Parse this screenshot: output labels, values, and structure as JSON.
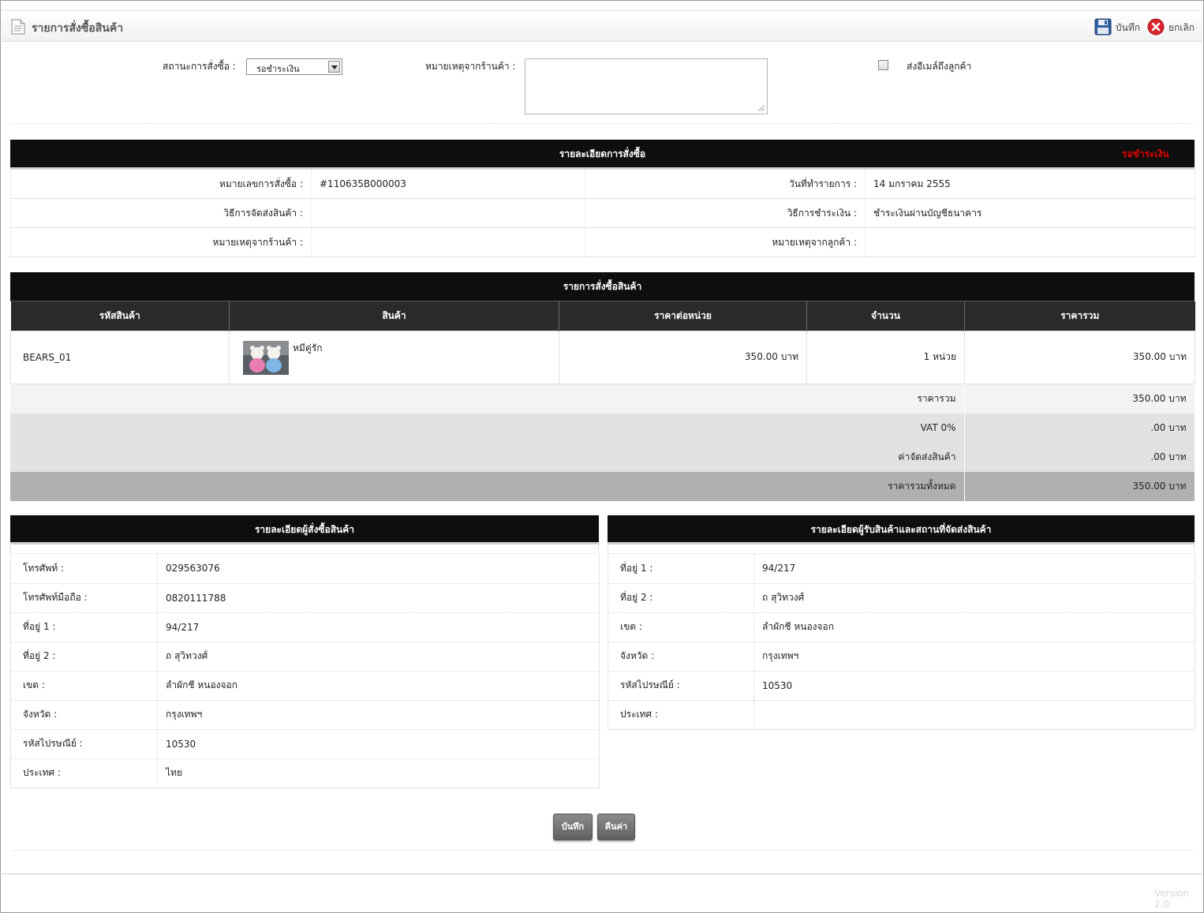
{
  "header": {
    "title": "รายการสั่งซื้อสินค้า",
    "save_label": "บันทึก",
    "cancel_label": "ยกเลิก"
  },
  "status_form": {
    "status_label": "สถานะการสั่งซื้อ :",
    "status_value": "รอชำระเงิน",
    "store_note_label": "หมายเหตุจากร้านค้า :",
    "store_note_value": "",
    "email_label": "ส่งอีเมล์ถึงลูกค้า",
    "email_checked": false
  },
  "order_details": {
    "title": "รายละเอียดการสั่งซื้อ",
    "status": "รอชำระเงิน",
    "order_no_label": "หมายเลขการสั่งซื้อ :",
    "order_no": "#110635B000003",
    "date_label": "วันที่ทำรายการ :",
    "date": "14 มกราคม 2555",
    "shipping_label": "วิธีการจัดส่งสินค้า :",
    "shipping": "",
    "payment_label": "วิธีการชำระเงิน :",
    "payment": "ชำระเงินผ่านบัญชีธนาคาร",
    "store_note_label": "หมายเหตุจากร้านค้า :",
    "store_note": "",
    "customer_note_label": "หมายเหตุจากลูกค้า :",
    "customer_note": ""
  },
  "items": {
    "title": "รายการสั่งซื้อสินค้า",
    "headers": [
      "รหัสสินค้า",
      "สินค้า",
      "ราคาต่อหน่วย",
      "จำนวน",
      "ราคารวม"
    ],
    "rows": [
      {
        "code": "BEARS_01",
        "name": "หมีคู่รัก",
        "unit_price": "350.00 บาท",
        "qty": "1 หน่วย",
        "total": "350.00 บาท"
      }
    ],
    "subtotal_label": "ราคารวม",
    "subtotal": "350.00 บาท",
    "vat_label": "VAT 0%",
    "vat": ".00 บาท",
    "shipping_label": "ค่าจัดส่งสินค้า",
    "shipping": ".00 บาท",
    "grand_label": "ราคารวมทั้งหมด",
    "grand": "350.00 บาท"
  },
  "buyer": {
    "title": "รายละเอียดผู้สั่งซื้อสินค้า",
    "rows": [
      {
        "label": "โทรศัพท์ :",
        "value": "029563076"
      },
      {
        "label": "โทรศัพท์มือถือ :",
        "value": "0820111788"
      },
      {
        "label": "ที่อยู่ 1 :",
        "value": "94/217"
      },
      {
        "label": "ที่อยู่ 2 :",
        "value": "ถ สุวิทวงศ์"
      },
      {
        "label": "เขต :",
        "value": "ลำผักชี หนองจอก"
      },
      {
        "label": "จังหวัด :",
        "value": "กรุงเทพฯ"
      },
      {
        "label": "รหัสไปรษณีย์ :",
        "value": "10530"
      },
      {
        "label": "ประเทศ :",
        "value": "ไทย"
      }
    ]
  },
  "receiver": {
    "title": "รายละเอียดผู้รับสินค้าและสถานที่จัดส่งสินค้า",
    "rows": [
      {
        "label": "ที่อยู่ 1 :",
        "value": "94/217"
      },
      {
        "label": "ที่อยู่ 2 :",
        "value": "ถ สุวิทวงศ์"
      },
      {
        "label": "เขต :",
        "value": "ลำผักชี หนองจอก"
      },
      {
        "label": "จังหวัด :",
        "value": "กรุงเทพฯ"
      },
      {
        "label": "รหัสไปรษณีย์ :",
        "value": "10530"
      },
      {
        "label": "ประเทศ :",
        "value": ""
      }
    ]
  },
  "footer": {
    "save_label": "บันทึก",
    "reset_label": "คืนค่า",
    "version": "Version 2.0"
  },
  "colors": {
    "status_red": "#e00000",
    "bar_black": "#0e0e0e",
    "button_grey": "#6f6f6f"
  }
}
